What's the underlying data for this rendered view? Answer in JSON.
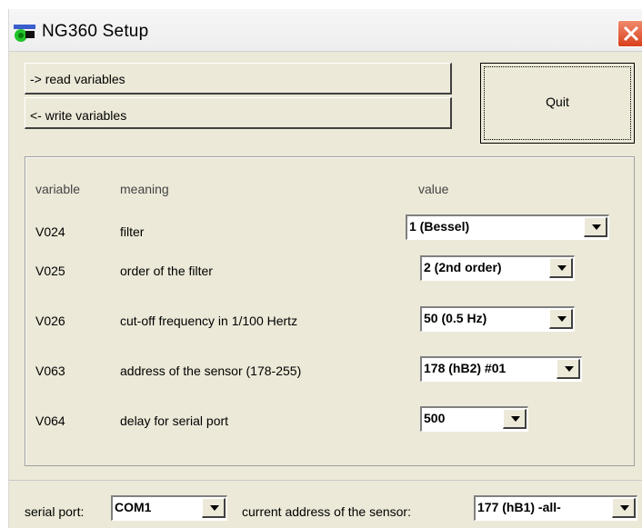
{
  "window": {
    "title": "NG360 Setup"
  },
  "buttons": {
    "read": "-> read variables",
    "write": "<- write variables",
    "quit": "Quit"
  },
  "table": {
    "headers": {
      "variable": "variable",
      "meaning": "meaning",
      "value": "value"
    },
    "rows": [
      {
        "variable": "V024",
        "meaning": "filter",
        "value": "1 (Bessel)"
      },
      {
        "variable": "V025",
        "meaning": "order of the filter",
        "value": "2 (2nd order)"
      },
      {
        "variable": "V026",
        "meaning": "cut-off frequency in 1/100 Hertz",
        "value": "50 (0.5 Hz)"
      },
      {
        "variable": "V063",
        "meaning": "address of the sensor (178-255)",
        "value": "178 (hB2) #01"
      },
      {
        "variable": "V064",
        "meaning": "delay for serial port",
        "value": "500"
      }
    ]
  },
  "footer": {
    "serial_port_label": "serial port:",
    "serial_port_value": "COM1",
    "current_address_label": "current address of the sensor:",
    "current_address_value": "177 (hB1) -all-"
  },
  "icons": {
    "app": "app-icon",
    "close": "close-icon",
    "dropdown": "chevron-down-icon"
  },
  "colors": {
    "window_bg": "#ece9d8",
    "close_button": "#d9401c"
  }
}
